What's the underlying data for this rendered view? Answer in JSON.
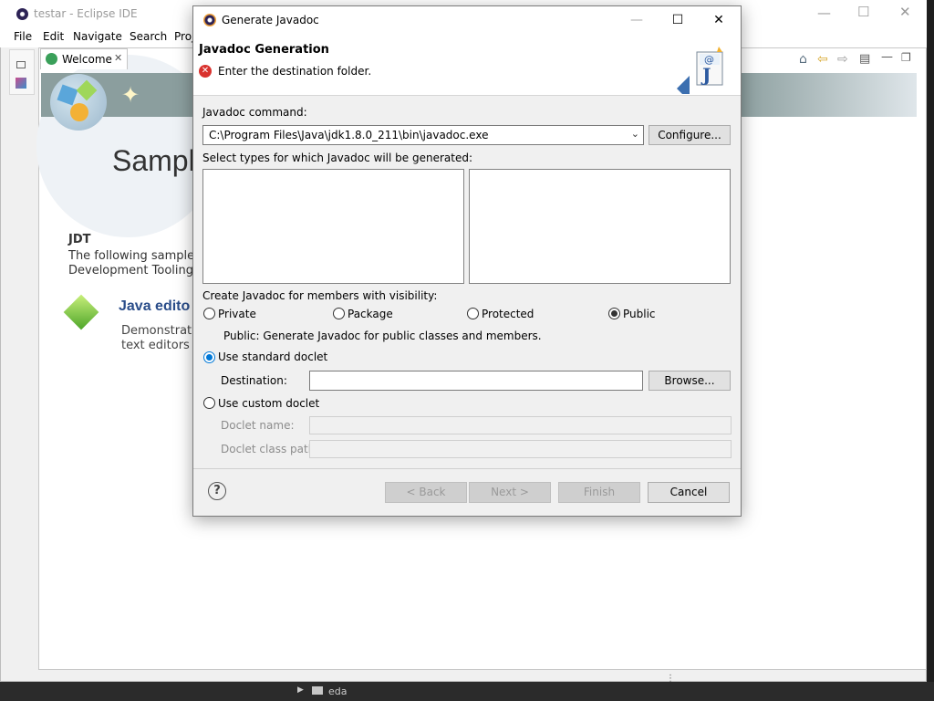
{
  "eclipse": {
    "title": "testar - Eclipse IDE",
    "menu": [
      "File",
      "Edit",
      "Navigate",
      "Search",
      "Proj"
    ],
    "welcome_tab": "Welcome",
    "sample_title": "Sampl",
    "jdt_heading": "JDT",
    "jdt_desc_1": "The following sample",
    "jdt_desc_2": "Development Tooling",
    "java_link": "Java edito",
    "java_desc_1": "Demonstrat",
    "java_desc_2": "text editors",
    "taskbar_label": "eda"
  },
  "dialog": {
    "title": "Generate Javadoc",
    "header_title": "Javadoc Generation",
    "error_message": "Enter the destination folder.",
    "javadoc_command_label": "Javadoc command:",
    "javadoc_command_value": "C:\\Program Files\\Java\\jdk1.8.0_211\\bin\\javadoc.exe",
    "configure_button": "Configure...",
    "select_types_label": "Select types for which Javadoc will be generated:",
    "visibility_label": "Create Javadoc for members with visibility:",
    "visibility_options": [
      "Private",
      "Package",
      "Protected",
      "Public"
    ],
    "visibility_selected": "Public",
    "visibility_desc": "Public: Generate Javadoc for public classes and members.",
    "standard_doclet_label": "Use standard doclet",
    "destination_label": "Destination:",
    "destination_value": "",
    "browse_button": "Browse...",
    "custom_doclet_label": "Use custom doclet",
    "doclet_name_label": "Doclet name:",
    "doclet_class_path_label": "Doclet class path:",
    "back_button": "< Back",
    "next_button": "Next >",
    "finish_button": "Finish",
    "cancel_button": "Cancel"
  },
  "icons": {
    "error": "error-icon",
    "help": "help-icon",
    "dropdown": "chevron-down-icon",
    "logo": "javadoc-wizard-icon"
  },
  "colors": {
    "accent": "#0078d7",
    "error": "#d9322e"
  }
}
